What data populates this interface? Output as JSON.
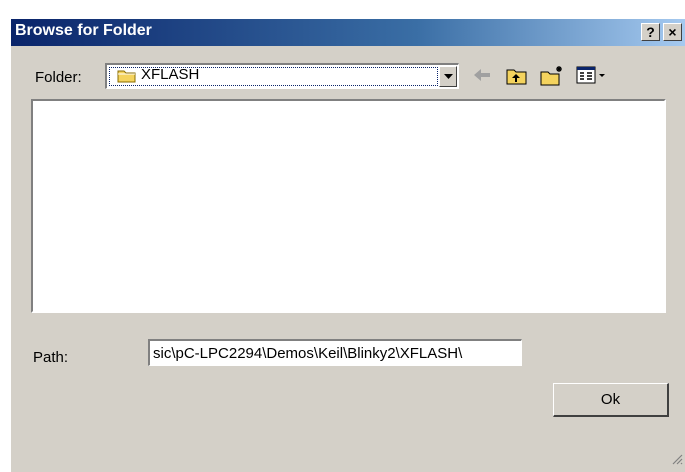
{
  "window": {
    "title": "Browse for Folder",
    "help_label": "?",
    "close_label": "×"
  },
  "folder": {
    "label": "Folder:",
    "value": "XFLASH",
    "icon": "folder-icon"
  },
  "toolbar": {
    "icons": [
      "back-arrow-icon",
      "up-folder-icon",
      "new-folder-icon",
      "views-icon"
    ]
  },
  "path": {
    "label": "Path:",
    "value": "sic\\pC-LPC2294\\Demos\\Keil\\Blinky2\\XFLASH\\"
  },
  "ok_label": "Ok",
  "colors": {
    "dialog_bg": "#d4d0c8",
    "title_start": "#0a246a",
    "title_end": "#a6caf0",
    "folder_yellow": "#f4d35e"
  }
}
